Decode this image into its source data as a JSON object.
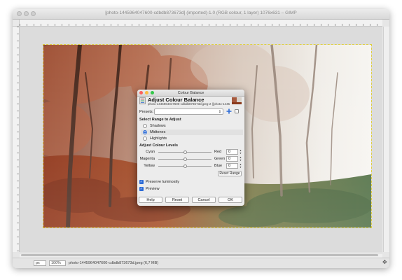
{
  "window": {
    "title": "[photo-1445964047600-cdbdb873673d] (imported)-1.0 (RGB colour, 1 layer) 1076x631 – GIMP"
  },
  "statusbar": {
    "unit": "px",
    "zoom": "100%",
    "file_info": "photo-1445964047600-cdbdb873673d.jpeg (6,7 MB)"
  },
  "dialog": {
    "window_title": "Colour Balance",
    "header_title": "Adjust Colour Balance",
    "header_subtitle": "photo-1445964047600-cdbdb873673d.jpeg-2 ([photo-1445964...",
    "presets_label": "Presets:",
    "presets_value": "",
    "range_heading": "Select Range to Adjust",
    "ranges": [
      {
        "label": "Shadows",
        "selected": false
      },
      {
        "label": "Midtones",
        "selected": true
      },
      {
        "label": "Highlights",
        "selected": false
      }
    ],
    "levels_heading": "Adjust Colour Levels",
    "sliders": [
      {
        "left": "Cyan",
        "right": "Red",
        "value": "0",
        "level": 0
      },
      {
        "left": "Magenta",
        "right": "Green",
        "value": "0",
        "level": 0
      },
      {
        "left": "Yellow",
        "right": "Blue",
        "value": "0",
        "level": 0
      }
    ],
    "reset_range_label": "Reset Range",
    "preserve_luminosity_label": "Preserve luminosity",
    "preserve_luminosity_checked": true,
    "preview_label": "Preview",
    "preview_checked": true,
    "buttons": {
      "help": "Help",
      "reset": "Reset",
      "cancel": "Cancel",
      "ok": "OK"
    }
  },
  "colors": {
    "accent": "#2c6bd6",
    "close": "#fc605c",
    "minimize": "#fdbc40",
    "zoom": "#34c84a"
  },
  "icons": [
    "navigate-icon",
    "add-preset-icon",
    "preset-menu-icon",
    "colour-balance-icon"
  ]
}
